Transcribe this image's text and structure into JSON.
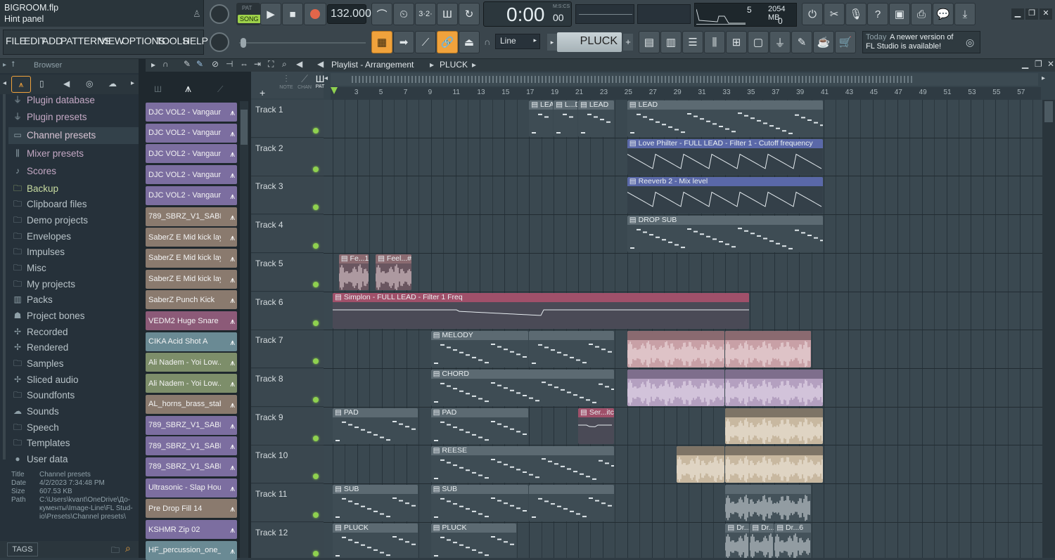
{
  "window": {
    "title": "BIGROOM.flp",
    "hint": "Hint panel"
  },
  "transport": {
    "pat_label": "PAT",
    "song_label": "SONG",
    "tempo": "132.000",
    "time": "0:00",
    "time_sub": "00",
    "time_unit": "M:S:CS"
  },
  "monitor": {
    "voices": "5",
    "memory": "2054 MB",
    "cpu": "0"
  },
  "menu": [
    "FILE",
    "EDIT",
    "ADD",
    "PATTERNS",
    "VIEW",
    "OPTIONS",
    "TOOLS",
    "HELP"
  ],
  "toolbar": {
    "snap": "Line",
    "pattern": "PLUCK",
    "plus": "+"
  },
  "news": {
    "today": "Today",
    "line1": "A newer version of",
    "line2": "FL Studio is available!"
  },
  "browser": {
    "title": "Browser",
    "items": [
      {
        "label": "Plugin database",
        "icon": "plug-icon"
      },
      {
        "label": "Plugin presets",
        "icon": "plug-icon"
      },
      {
        "label": "Channel presets",
        "icon": "channel-icon"
      },
      {
        "label": "Mixer presets",
        "icon": "mixer-icon"
      },
      {
        "label": "Scores",
        "icon": "note-icon"
      },
      {
        "label": "Backup",
        "icon": "folder-icon"
      },
      {
        "label": "Clipboard files",
        "icon": "folder-icon"
      },
      {
        "label": "Demo projects",
        "icon": "folder-icon"
      },
      {
        "label": "Envelopes",
        "icon": "folder-icon"
      },
      {
        "label": "Impulses",
        "icon": "folder-icon"
      },
      {
        "label": "Misc",
        "icon": "folder-icon"
      },
      {
        "label": "My projects",
        "icon": "folder-icon"
      },
      {
        "label": "Packs",
        "icon": "pack-icon"
      },
      {
        "label": "Project bones",
        "icon": "bones-icon"
      },
      {
        "label": "Recorded",
        "icon": "recorded-icon"
      },
      {
        "label": "Rendered",
        "icon": "rendered-icon"
      },
      {
        "label": "Samples",
        "icon": "folder-icon"
      },
      {
        "label": "Sliced audio",
        "icon": "sliced-icon"
      },
      {
        "label": "Soundfonts",
        "icon": "folder-icon"
      },
      {
        "label": "Sounds",
        "icon": "cloud-icon"
      },
      {
        "label": "Speech",
        "icon": "folder-icon"
      },
      {
        "label": "Templates",
        "icon": "folder-icon"
      },
      {
        "label": "User data",
        "icon": "user-icon"
      }
    ],
    "info": {
      "title_k": "Title",
      "title_v": "Channel presets",
      "date_k": "Date",
      "date_v": "4/2/2023 7:34:48 PM",
      "size_k": "Size",
      "size_v": "607.53 KB",
      "path_k": "Path",
      "path_v1": "C:\\Users\\kvant\\OneDrive\\До-",
      "path_v2": "кументы\\Image-Line\\FL Stud-",
      "path_v3": "io\\Presets\\Channel presets\\"
    },
    "tags": "TAGS"
  },
  "channels": [
    {
      "name": "DJC VOL2 - Vangaurd...",
      "color": "#7c6ea0"
    },
    {
      "name": "DJC VOL2 - Vangaurd...",
      "color": "#7c6ea0"
    },
    {
      "name": "DJC VOL2 - Vangaurd...",
      "color": "#7c6ea0"
    },
    {
      "name": "DJC VOL2 - Vangaurd...",
      "color": "#7c6ea0"
    },
    {
      "name": "DJC VOL2 - Vangaurd...",
      "color": "#7c6ea0"
    },
    {
      "name": "789_SBRZ_V1_SABER...",
      "color": "#8a7a6e"
    },
    {
      "name": "SaberZ E Mid kick layer",
      "color": "#8a7a6e"
    },
    {
      "name": "SaberZ E Mid kick lay...",
      "color": "#8a7a6e"
    },
    {
      "name": "SaberZ E Mid kick lay...",
      "color": "#8a7a6e"
    },
    {
      "name": "SaberZ Punch Kick",
      "color": "#8a7a6e"
    },
    {
      "name": "VEDM2 Huge Snare 00...",
      "color": "#8c5a78"
    },
    {
      "name": "CIKA Acid Shot A",
      "color": "#6a8a94"
    },
    {
      "name": "Ali Nadem - Yoi Low...",
      "color": "#7d8e6a"
    },
    {
      "name": "Ali Nadem - Yoi Low...",
      "color": "#7d8e6a"
    },
    {
      "name": "AL_horns_brass_stab...",
      "color": "#8a7a6e"
    },
    {
      "name": "789_SBRZ_V1_SABER...",
      "color": "#7c6ea0"
    },
    {
      "name": "789_SBRZ_V1_SABER...",
      "color": "#7c6ea0"
    },
    {
      "name": "789_SBRZ_V1_SABER...",
      "color": "#7c6ea0"
    },
    {
      "name": "Ultrasonic - Slap Hou...",
      "color": "#7c6ea0"
    },
    {
      "name": "Pre Drop Fill 14",
      "color": "#8a7a6e"
    },
    {
      "name": "KSHMR Zip 02",
      "color": "#7c6ea0"
    },
    {
      "name": "HF_percussion_one_...",
      "color": "#6a8a94"
    }
  ],
  "playlist": {
    "title": "Playlist - Arrangement",
    "pattern": "PLUCK",
    "tabs": [
      "NOTE",
      "CHAN",
      "PAT"
    ],
    "bars": [
      "3",
      "5",
      "7",
      "9",
      "11",
      "13",
      "15",
      "17",
      "19",
      "21",
      "23",
      "25",
      "27",
      "29",
      "31",
      "33",
      "35",
      "37",
      "39",
      "41",
      "43",
      "45",
      "47",
      "49",
      "51",
      "53",
      "55",
      "57"
    ],
    "tracks": [
      "Track 1",
      "Track 2",
      "Track 3",
      "Track 4",
      "Track 5",
      "Track 6",
      "Track 7",
      "Track 8",
      "Track 9",
      "Track 10",
      "Track 11",
      "Track 12"
    ],
    "clips": [
      {
        "track": 0,
        "start": 17,
        "len": 2,
        "label": "LEAD",
        "kind": "pattern"
      },
      {
        "track": 0,
        "start": 19,
        "len": 2,
        "label": "L...D",
        "kind": "pattern"
      },
      {
        "track": 0,
        "start": 21,
        "len": 3,
        "label": "LEAD",
        "kind": "pattern"
      },
      {
        "track": 0,
        "start": 25,
        "len": 16,
        "label": "LEAD",
        "kind": "pattern"
      },
      {
        "track": 1,
        "start": 25,
        "len": 16,
        "label": "Love Philter - FULL LEAD - Filter 1 - Cutoff frequency",
        "kind": "auto"
      },
      {
        "track": 2,
        "start": 25,
        "len": 16,
        "label": "Reeverb 2 - Mix level",
        "kind": "auto"
      },
      {
        "track": 3,
        "start": 25,
        "len": 16,
        "label": "DROP SUB",
        "kind": "pattern"
      },
      {
        "track": 4,
        "start": 1.5,
        "len": 2.5,
        "label": "Fe...1",
        "kind": "audio"
      },
      {
        "track": 4,
        "start": 4.5,
        "len": 3,
        "label": "Feel...#2",
        "kind": "audio"
      },
      {
        "track": 5,
        "start": 1,
        "len": 34,
        "label": "Simplon - FULL LEAD - Filter 1 Freq",
        "kind": "autopink"
      },
      {
        "track": 6,
        "start": 9,
        "len": 8,
        "label": "MELODY",
        "kind": "pattern"
      },
      {
        "track": 6,
        "start": 17,
        "len": 7,
        "label": "",
        "kind": "pattern"
      },
      {
        "track": 6,
        "start": 25,
        "len": 8,
        "label": "",
        "kind": "audiopink"
      },
      {
        "track": 6,
        "start": 33,
        "len": 7,
        "label": "",
        "kind": "audiopink"
      },
      {
        "track": 7,
        "start": 9,
        "len": 15,
        "label": "CHORD",
        "kind": "pattern"
      },
      {
        "track": 7,
        "start": 25,
        "len": 8,
        "label": "",
        "kind": "audiolilac"
      },
      {
        "track": 7,
        "start": 33,
        "len": 8,
        "label": "",
        "kind": "audiolilac"
      },
      {
        "track": 8,
        "start": 1,
        "len": 7,
        "label": "PAD",
        "kind": "pattern"
      },
      {
        "track": 8,
        "start": 9,
        "len": 8,
        "label": "PAD",
        "kind": "pattern"
      },
      {
        "track": 8,
        "start": 21,
        "len": 3,
        "label": "Ser...itch",
        "kind": "autopink"
      },
      {
        "track": 8,
        "start": 33,
        "len": 8,
        "label": "",
        "kind": "audiotan"
      },
      {
        "track": 9,
        "start": 9,
        "len": 15,
        "label": "REESE",
        "kind": "pattern"
      },
      {
        "track": 9,
        "start": 29,
        "len": 4,
        "label": "",
        "kind": "audiotan"
      },
      {
        "track": 9,
        "start": 33,
        "len": 8,
        "label": "",
        "kind": "audiotan"
      },
      {
        "track": 10,
        "start": 1,
        "len": 7,
        "label": "SUB",
        "kind": "pattern"
      },
      {
        "track": 10,
        "start": 9,
        "len": 8,
        "label": "SUB",
        "kind": "pattern"
      },
      {
        "track": 10,
        "start": 17,
        "len": 7,
        "label": "",
        "kind": "pattern"
      },
      {
        "track": 10,
        "start": 33,
        "len": 7,
        "label": "",
        "kind": "audiogray"
      },
      {
        "track": 11,
        "start": 1,
        "len": 7,
        "label": "PLUCK",
        "kind": "pattern"
      },
      {
        "track": 11,
        "start": 9,
        "len": 7,
        "label": "PLUCK",
        "kind": "pattern"
      },
      {
        "track": 11,
        "start": 33,
        "len": 2,
        "label": "Dr...6",
        "kind": "audiogray"
      },
      {
        "track": 11,
        "start": 35,
        "len": 2,
        "label": "Dr...6",
        "kind": "audiogray"
      },
      {
        "track": 11,
        "start": 37,
        "len": 3,
        "label": "Dr...6",
        "kind": "audiogray"
      }
    ]
  },
  "colors": {
    "accent": "#f0a23c",
    "led": "#8fd14f",
    "pattern": "#4a5860",
    "auto": "#5a68a8",
    "autopink": "#a0506a"
  }
}
